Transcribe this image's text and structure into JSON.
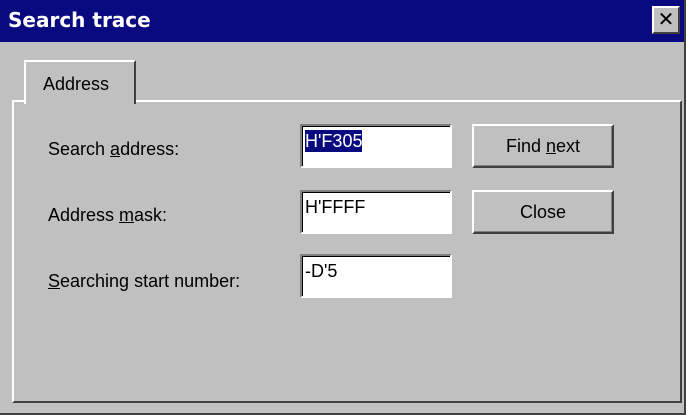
{
  "window": {
    "title": "Search trace",
    "close_glyph": "✕"
  },
  "tabs": [
    {
      "label": "Address",
      "active": true
    }
  ],
  "form": {
    "search_address": {
      "label_pre": "Search ",
      "label_accel": "a",
      "label_post": "ddress:",
      "value": "H'F305",
      "selected": true
    },
    "address_mask": {
      "label_pre": "Address ",
      "label_accel": "m",
      "label_post": "ask:",
      "value": "H'FFFF"
    },
    "start_number": {
      "label_pre": "",
      "label_accel": "S",
      "label_post": "earching start number:",
      "value": "-D'5"
    }
  },
  "buttons": {
    "find_next": {
      "pre": "Find ",
      "accel": "n",
      "post": "ext"
    },
    "close": {
      "label": "Close"
    }
  },
  "colors": {
    "titlebar": "#0a0a80",
    "face": "#c0c0c0",
    "selection": "#0a0a80"
  },
  "icons": {
    "close": "close-icon"
  }
}
